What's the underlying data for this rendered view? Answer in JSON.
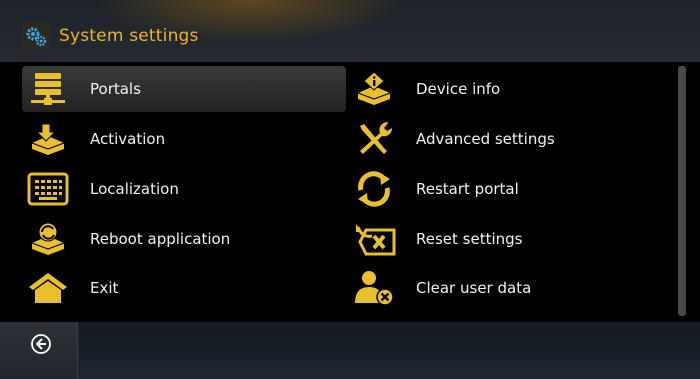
{
  "header": {
    "title": "System settings",
    "icon": "gears-icon"
  },
  "menu": {
    "left": [
      {
        "label": "Portals",
        "icon": "server-icon",
        "selected": true
      },
      {
        "label": "Activation",
        "icon": "download-box-icon"
      },
      {
        "label": "Localization",
        "icon": "keyboard-icon"
      },
      {
        "label": "Reboot application",
        "icon": "reload-box-icon"
      },
      {
        "label": "Exit",
        "icon": "home-icon"
      }
    ],
    "right": [
      {
        "label": "Device info",
        "icon": "info-box-icon"
      },
      {
        "label": "Advanced settings",
        "icon": "tools-icon"
      },
      {
        "label": "Restart portal",
        "icon": "restart-icon"
      },
      {
        "label": "Reset settings",
        "icon": "reset-icon"
      },
      {
        "label": "Clear user data",
        "icon": "user-clear-icon"
      }
    ]
  },
  "footer": {
    "back_icon": "back-icon"
  },
  "colors": {
    "accent": "#f0b518",
    "icon_yellow": "#e9c02c",
    "panel": "#000000"
  }
}
